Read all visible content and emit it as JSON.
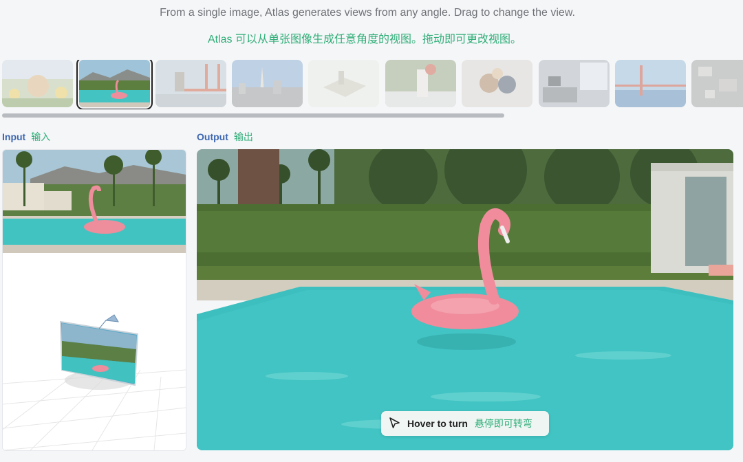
{
  "description_en": "From a single image, Atlas generates views from any angle. Drag to change the view.",
  "description_zh": "Atlas 可以从单张图像生成任意角度的视图。拖动即可更改视图。",
  "thumbnails": [
    {
      "name": "garden-scene"
    },
    {
      "name": "flamingo-pool",
      "selected": true
    },
    {
      "name": "golden-gate-sculpture"
    },
    {
      "name": "city-skyline"
    },
    {
      "name": "miniature-model"
    },
    {
      "name": "lab-equipment"
    },
    {
      "name": "toy-figures"
    },
    {
      "name": "office-interior"
    },
    {
      "name": "golden-gate-bridge"
    },
    {
      "name": "aerial-city"
    }
  ],
  "input_label": {
    "en": "Input",
    "zh": "输入"
  },
  "output_label": {
    "en": "Output",
    "zh": "输出"
  },
  "hover_hint": {
    "en": "Hover to turn",
    "zh": "悬停即可转弯",
    "icon": "cursor-arrow-icon"
  },
  "colors": {
    "accent_green": "#2fae78",
    "accent_blue": "#3d67b0",
    "pool": "#3fc3c3",
    "flamingo": "#f08c9c"
  }
}
